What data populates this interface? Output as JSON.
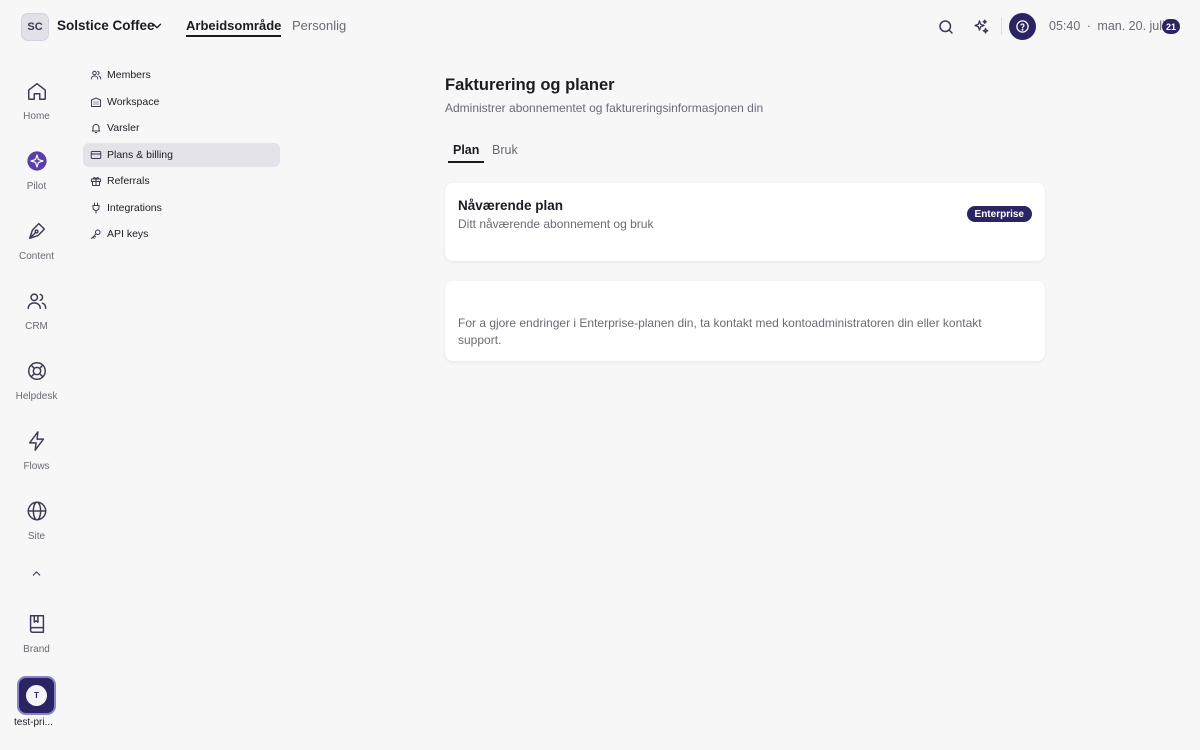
{
  "topbar": {
    "workspace_initials": "SC",
    "workspace_name": "Solstice Coffee",
    "tabs": [
      {
        "label": "Arbeidsområde",
        "active": true
      },
      {
        "label": "Personlig",
        "active": false
      }
    ],
    "time": "05:40",
    "separator": "·",
    "date": "man. 20. juli",
    "day_badge": "21"
  },
  "rail": {
    "items": [
      {
        "label": "Home",
        "icon": "home-icon"
      },
      {
        "label": "Pilot",
        "icon": "pilot-icon"
      },
      {
        "label": "Content",
        "icon": "pen-icon"
      },
      {
        "label": "CRM",
        "icon": "users-icon"
      },
      {
        "label": "Helpdesk",
        "icon": "lifebuoy-icon"
      },
      {
        "label": "Flows",
        "icon": "bolt-icon"
      },
      {
        "label": "Site",
        "icon": "globe-icon"
      },
      {
        "label": "Brand",
        "icon": "book-icon"
      }
    ],
    "user": {
      "initial": "T",
      "label": "test-pri..."
    }
  },
  "settings_nav": {
    "items": [
      {
        "label": "Members",
        "icon": "members-icon",
        "active": false
      },
      {
        "label": "Workspace",
        "icon": "building-icon",
        "active": false
      },
      {
        "label": "Varsler",
        "icon": "bell-icon",
        "active": false
      },
      {
        "label": "Plans & billing",
        "icon": "card-icon",
        "active": true
      },
      {
        "label": "Referrals",
        "icon": "gift-icon",
        "active": false
      },
      {
        "label": "Integrations",
        "icon": "plug-icon",
        "active": false
      },
      {
        "label": "API keys",
        "icon": "key-icon",
        "active": false
      }
    ]
  },
  "main": {
    "title": "Fakturering og planer",
    "subtitle": "Administrer abonnementet og faktureringsinformasjonen din",
    "tabs": [
      {
        "label": "Plan",
        "active": true
      },
      {
        "label": "Bruk",
        "active": false
      }
    ],
    "plan_card": {
      "title": "Nåværende plan",
      "subtitle": "Ditt nåværende abonnement og bruk",
      "badge": "Enterprise"
    },
    "info_card": {
      "text": "For a gjore endringer i Enterprise-planen din, ta kontakt med kontoadministratoren din eller kontakt support."
    }
  },
  "colors": {
    "accent": "#2b2464",
    "background": "#f7f7f8",
    "card": "#ffffff",
    "active_nav": "#e4e3ea",
    "muted_text": "#6b6a75"
  }
}
